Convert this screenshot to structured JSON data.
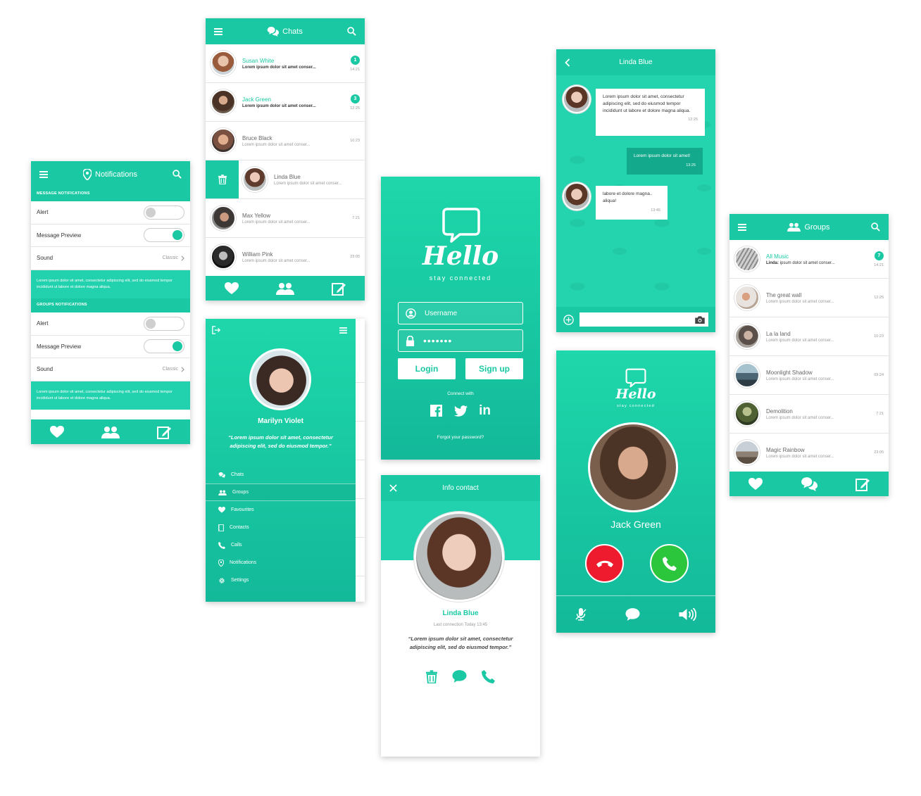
{
  "colors": {
    "accent": "#1ac9a3",
    "accent_dark": "#13a98c",
    "decline": "#ee1b2e",
    "accept": "#2bc63b"
  },
  "notifications": {
    "title": "Notifications",
    "message_section": "MESSAGE NOTIFICATIONS",
    "groups_section": "GROUPS NOTIFICATIONS",
    "alert": "Alert",
    "preview": "Message Preview",
    "sound": "Sound",
    "sound_value": "Classic",
    "lorem": "Lorem ipsum dolor sit amet, consectetur adipiscing elit, sed do eiusmod tempor incididunt ut labore et dolore magna aliqua.",
    "message_alert_on": false,
    "message_preview_on": true,
    "groups_alert_on": false,
    "groups_preview_on": true
  },
  "chats": {
    "title": "Chats",
    "items": [
      {
        "name": "Susan White",
        "msg": "Lorem ipsum dolor sit amet conser...",
        "time": "14:21",
        "badge": "1"
      },
      {
        "name": "Jack Green",
        "msg": "Lorem ipsum dolor sit amet conser...",
        "time": "12:25",
        "badge": "3"
      },
      {
        "name": "Bruce Black",
        "msg": "Lorem ipsum dolor sit amet conser...",
        "time": "10:23"
      },
      {
        "name": "Linda Blue",
        "msg": "Lorem ipsum dolor sit amet conser..."
      },
      {
        "name": "Max Yellow",
        "msg": "Lorem ipsum dolor sit amet conser...",
        "time": "7:21"
      },
      {
        "name": "William Pink",
        "msg": "Lorem ipsum dolor sit amet conser...",
        "time": "23:05"
      }
    ]
  },
  "menu": {
    "name": "Marilyn Violet",
    "quote": "“Lorem ipsum dolor sit amet, consectetur adipiscing elit, sed do eiusmod tempor.”",
    "items": [
      "Chats",
      "Groups",
      "Favourites",
      "Contacts",
      "Calls",
      "Notifications",
      "Settings"
    ]
  },
  "login": {
    "logo": "Hello",
    "tagline": "stay connected",
    "username_placeholder": "Username",
    "password_mask": "•••••••",
    "login_label": "Login",
    "signup_label": "Sign up",
    "connect_with": "Connect with",
    "forgot": "Forgot your password?"
  },
  "info": {
    "title": "Info contact",
    "name": "Linda Blue",
    "last_connection": "Last connection Today 13:45",
    "quote": "“Lorem ipsum dolor sit amet, consectetur adipiscing elit, sed do eiusmod tempor.”"
  },
  "conversation": {
    "title": "Linda Blue",
    "messages": [
      {
        "text": "Lorem ipsum dolor sit amet, consectetur adipiscing elit, sed do eiusmod tempor incididunt ut labore et dolore magna aliqua.",
        "time": "12:25"
      },
      {
        "text": "Lorem ipsum dolor sit amet!",
        "time": "13:25"
      },
      {
        "text": "labore et dolore magna.. aliqua!",
        "time": "13:45"
      }
    ]
  },
  "call": {
    "logo": "Hello",
    "tagline": "stay connected",
    "name": "Jack Green"
  },
  "groups": {
    "title": "Groups",
    "items": [
      {
        "name": "All Music",
        "sender": "Linda:",
        "msg": " ipsum dolor sit amet conser...",
        "time": "14:21",
        "badge": "7"
      },
      {
        "name": "The great wall",
        "msg": "Lorem ipsum dolor sit amet conser...",
        "time": "12:25"
      },
      {
        "name": "La la land",
        "msg": "Lorem ipsum dolor sit amet conser...",
        "time": "10:23"
      },
      {
        "name": "Moonlight Shadow",
        "msg": "Lorem ipsum dolor sit amet conser...",
        "time": "09:24"
      },
      {
        "name": "Demolition",
        "msg": "Lorem ipsum dolor sit amet conser...",
        "time": "7:21"
      },
      {
        "name": "Magic Rainbow",
        "msg": "Lorem ipsum dolor sit amet conser...",
        "time": "23:05"
      }
    ]
  }
}
